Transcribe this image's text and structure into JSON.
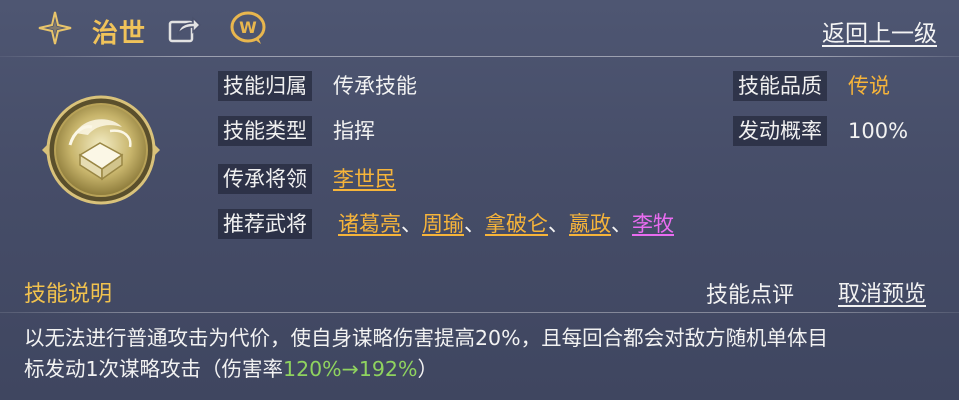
{
  "header": {
    "skill_name": "治世",
    "back_label": "返回上一级"
  },
  "icons": {
    "title": "four-point-star-icon",
    "share": "share-icon",
    "chat": "chat-bubble-icon",
    "skill": "skill-emblem-icon"
  },
  "left_fields": [
    {
      "label": "技能归属",
      "value": "传承技能"
    },
    {
      "label": "技能类型",
      "value": "指挥"
    },
    {
      "label": "传承将领",
      "value": "李世民"
    }
  ],
  "recommend": {
    "label": "推荐武将",
    "heroes": [
      "诸葛亮",
      "周瑜",
      "拿破仑",
      "嬴政",
      "李牧"
    ],
    "separator": "、"
  },
  "right_fields": [
    {
      "label": "技能品质",
      "value": "传说"
    },
    {
      "label": "发动概率",
      "value": "100%"
    }
  ],
  "description": {
    "title": "技能说明",
    "review_label": "技能点评",
    "cancel_label": "取消预览",
    "line1": "以无法进行普通攻击为代价，使自身谋略伤害提高20%，且每回合都会对敌方随机单体目",
    "line2_prefix": "标发动1次谋略攻击（伤害率",
    "line2_rate": "120%→192%",
    "line2_suffix": "）"
  },
  "colors": {
    "gold": "#f6b43a",
    "title_gold": "#f0c35a",
    "pink": "#e96cf0",
    "green": "#8fd35f",
    "background": "#4a516c"
  }
}
